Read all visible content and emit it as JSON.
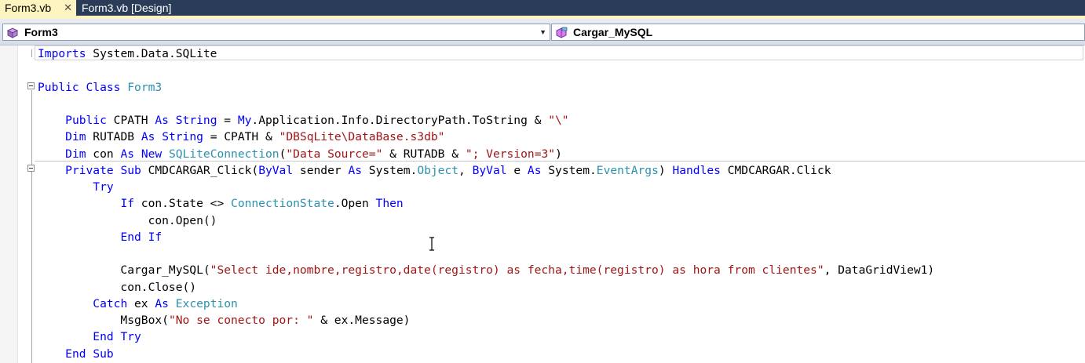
{
  "tabs": [
    {
      "label": "Form3.vb",
      "active": true,
      "close": "✕"
    },
    {
      "label": "Form3.vb [Design]",
      "active": false
    }
  ],
  "navbar": {
    "class_combo": "Form3",
    "member_combo": "Cargar_MySQL"
  },
  "code": [
    [
      [
        "Imports",
        "kw"
      ],
      [
        " System.Data.SQLite",
        ""
      ]
    ],
    [],
    [
      [
        "Public",
        "kw"
      ],
      [
        " ",
        ""
      ],
      [
        "Class",
        "kw"
      ],
      [
        " ",
        ""
      ],
      [
        "Form3",
        "ty"
      ]
    ],
    [],
    [
      [
        "    ",
        ""
      ],
      [
        "Public",
        "kw"
      ],
      [
        " CPATH ",
        ""
      ],
      [
        "As",
        "kw"
      ],
      [
        " ",
        ""
      ],
      [
        "String",
        "kw"
      ],
      [
        " = ",
        ""
      ],
      [
        "My",
        "kw"
      ],
      [
        ".Application.Info.DirectoryPath.ToString & ",
        ""
      ],
      [
        "\"\\\"",
        "st"
      ]
    ],
    [
      [
        "    ",
        ""
      ],
      [
        "Dim",
        "kw"
      ],
      [
        " RUTADB ",
        ""
      ],
      [
        "As",
        "kw"
      ],
      [
        " ",
        ""
      ],
      [
        "String",
        "kw"
      ],
      [
        " = CPATH & ",
        ""
      ],
      [
        "\"DBSqLite\\DataBase.s3db\"",
        "st"
      ]
    ],
    [
      [
        "    ",
        ""
      ],
      [
        "Dim",
        "kw"
      ],
      [
        " con ",
        ""
      ],
      [
        "As",
        "kw"
      ],
      [
        " ",
        ""
      ],
      [
        "New",
        "kw"
      ],
      [
        " ",
        ""
      ],
      [
        "SQLiteConnection",
        "ty"
      ],
      [
        "(",
        ""
      ],
      [
        "\"Data Source=\"",
        "st"
      ],
      [
        " & RUTADB & ",
        ""
      ],
      [
        "\"; Version=3\"",
        "st"
      ],
      [
        ")",
        ""
      ]
    ],
    [
      [
        "    ",
        ""
      ],
      [
        "Private",
        "kw"
      ],
      [
        " ",
        ""
      ],
      [
        "Sub",
        "kw"
      ],
      [
        " CMDCARGAR_Click(",
        ""
      ],
      [
        "ByVal",
        "kw"
      ],
      [
        " sender ",
        ""
      ],
      [
        "As",
        "kw"
      ],
      [
        " System.",
        ""
      ],
      [
        "Object",
        "ty"
      ],
      [
        ", ",
        ""
      ],
      [
        "ByVal",
        "kw"
      ],
      [
        " e ",
        ""
      ],
      [
        "As",
        "kw"
      ],
      [
        " System.",
        ""
      ],
      [
        "EventArgs",
        "ty"
      ],
      [
        ") ",
        ""
      ],
      [
        "Handles",
        "kw"
      ],
      [
        " CMDCARGAR.Click",
        ""
      ]
    ],
    [
      [
        "        ",
        ""
      ],
      [
        "Try",
        "kw"
      ]
    ],
    [
      [
        "            ",
        ""
      ],
      [
        "If",
        "kw"
      ],
      [
        " con.State <> ",
        ""
      ],
      [
        "ConnectionState",
        "ty"
      ],
      [
        ".Open ",
        ""
      ],
      [
        "Then",
        "kw"
      ]
    ],
    [
      [
        "                con.Open()",
        ""
      ]
    ],
    [
      [
        "            ",
        ""
      ],
      [
        "End",
        "kw"
      ],
      [
        " ",
        ""
      ],
      [
        "If",
        "kw"
      ]
    ],
    [],
    [
      [
        "            Cargar_MySQL(",
        ""
      ],
      [
        "\"Select ide,nombre,registro,date(registro) as fecha,time(registro) as hora from clientes\"",
        "st"
      ],
      [
        ", DataGridView1)",
        ""
      ]
    ],
    [
      [
        "            con.Close()",
        ""
      ]
    ],
    [
      [
        "        ",
        ""
      ],
      [
        "Catch",
        "kw"
      ],
      [
        " ex ",
        ""
      ],
      [
        "As",
        "kw"
      ],
      [
        " ",
        ""
      ],
      [
        "Exception",
        "ty"
      ]
    ],
    [
      [
        "            MsgBox(",
        ""
      ],
      [
        "\"No se conecto por: \"",
        "st"
      ],
      [
        " & ex.Message)",
        ""
      ]
    ],
    [
      [
        "        ",
        ""
      ],
      [
        "End",
        "kw"
      ],
      [
        " ",
        ""
      ],
      [
        "Try",
        "kw"
      ]
    ],
    [
      [
        "    ",
        ""
      ],
      [
        "End",
        "kw"
      ],
      [
        " ",
        ""
      ],
      [
        "Sub",
        "kw"
      ]
    ]
  ],
  "colors": {
    "keyword": "#0000ff",
    "type": "#2b91af",
    "string": "#a31515",
    "tab_active": "#fdf4bf",
    "tab_strip": "#2b3c59"
  }
}
